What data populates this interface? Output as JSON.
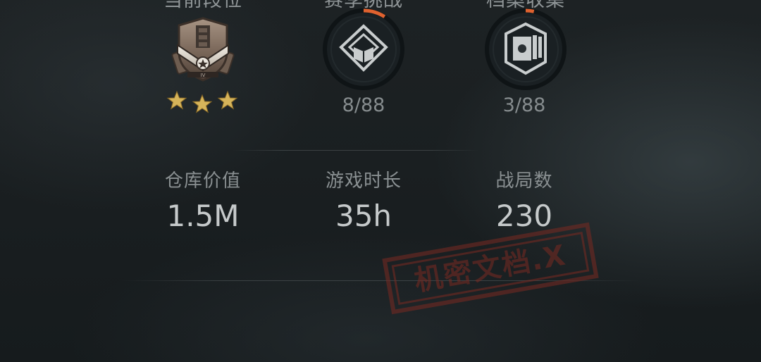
{
  "top_section": {
    "columns": [
      {
        "label": "当前段位",
        "kind": "rank",
        "stars": 3
      },
      {
        "label": "赛季挑战",
        "progress_text": "8/88",
        "progress_fraction": 0.0909,
        "icon": "book-cube-icon"
      },
      {
        "label": "档案收集",
        "progress_text": "3/88",
        "progress_fraction": 0.0341,
        "icon": "archive-box-icon"
      }
    ]
  },
  "stats": [
    {
      "label": "仓库价值",
      "value": "1.5M"
    },
    {
      "label": "游戏时长",
      "value": "35h"
    },
    {
      "label": "战局数",
      "value": "230"
    }
  ],
  "stamp": {
    "text": "机密文档.X"
  },
  "colors": {
    "accent_orange": "#e0622f",
    "ring_track": "#11171a",
    "text_primary": "#c6cacb",
    "text_secondary": "#8a9092",
    "star_gold": "#d6b45a"
  }
}
